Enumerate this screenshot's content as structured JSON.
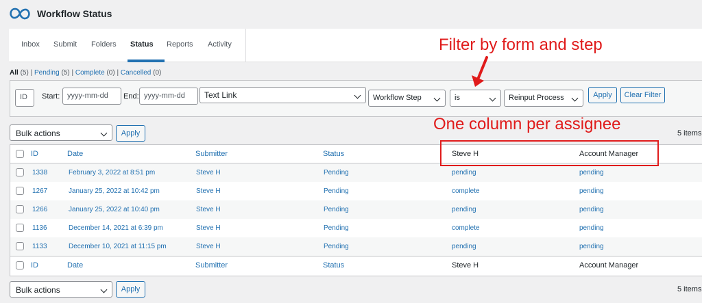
{
  "header": {
    "title": "Workflow Status"
  },
  "tabs": [
    {
      "label": "Inbox"
    },
    {
      "label": "Submit"
    },
    {
      "label": "Folders"
    },
    {
      "label": "Status"
    },
    {
      "label": "Reports"
    },
    {
      "label": "Activity"
    }
  ],
  "views": {
    "all_label": "All",
    "all_count": "(5)",
    "pending_label": "Pending",
    "pending_count": "(5)",
    "complete_label": "Complete",
    "complete_count": "(0)",
    "cancelled_label": "Cancelled",
    "cancelled_count": "(0)",
    "separator": "|"
  },
  "filter": {
    "id_placeholder": "ID",
    "start_label": "Start:",
    "start_placeholder": "yyyy-mm-dd",
    "end_label": "End:",
    "end_placeholder": "yyyy-mm-dd",
    "form_value": "Text Link",
    "field_value": "Workflow Step",
    "operator_value": "is",
    "step_value": "Reinput Process",
    "apply_label": "Apply",
    "clear_label": "Clear Filter"
  },
  "annotations": {
    "filter_note": "Filter by form and step",
    "column_note": "One column per assignee"
  },
  "bulk": {
    "label": "Bulk actions",
    "apply_label": "Apply",
    "items_count": "5 items"
  },
  "table": {
    "headers": {
      "id": "ID",
      "date": "Date",
      "submitter": "Submitter",
      "status": "Status",
      "assignee1": "Steve H",
      "assignee2": "Account Manager"
    },
    "rows": [
      {
        "id": "1338",
        "date": "February 3, 2022 at 8:51 pm",
        "submitter": "Steve H",
        "status": "Pending",
        "assignee1": "pending",
        "assignee2": "pending"
      },
      {
        "id": "1267",
        "date": "January 25, 2022 at 10:42 pm",
        "submitter": "Steve H",
        "status": "Pending",
        "assignee1": "complete",
        "assignee2": "pending"
      },
      {
        "id": "1266",
        "date": "January 25, 2022 at 10:40 pm",
        "submitter": "Steve H",
        "status": "Pending",
        "assignee1": "pending",
        "assignee2": "pending"
      },
      {
        "id": "1136",
        "date": "December 14, 2021 at 6:39 pm",
        "submitter": "Steve H",
        "status": "Pending",
        "assignee1": "complete",
        "assignee2": "pending"
      },
      {
        "id": "1133",
        "date": "December 10, 2021 at 11:15 pm",
        "submitter": "Steve H",
        "status": "Pending",
        "assignee1": "pending",
        "assignee2": "pending"
      }
    ]
  },
  "colors": {
    "accent": "#2271b1",
    "annotation": "#e01b1b"
  }
}
